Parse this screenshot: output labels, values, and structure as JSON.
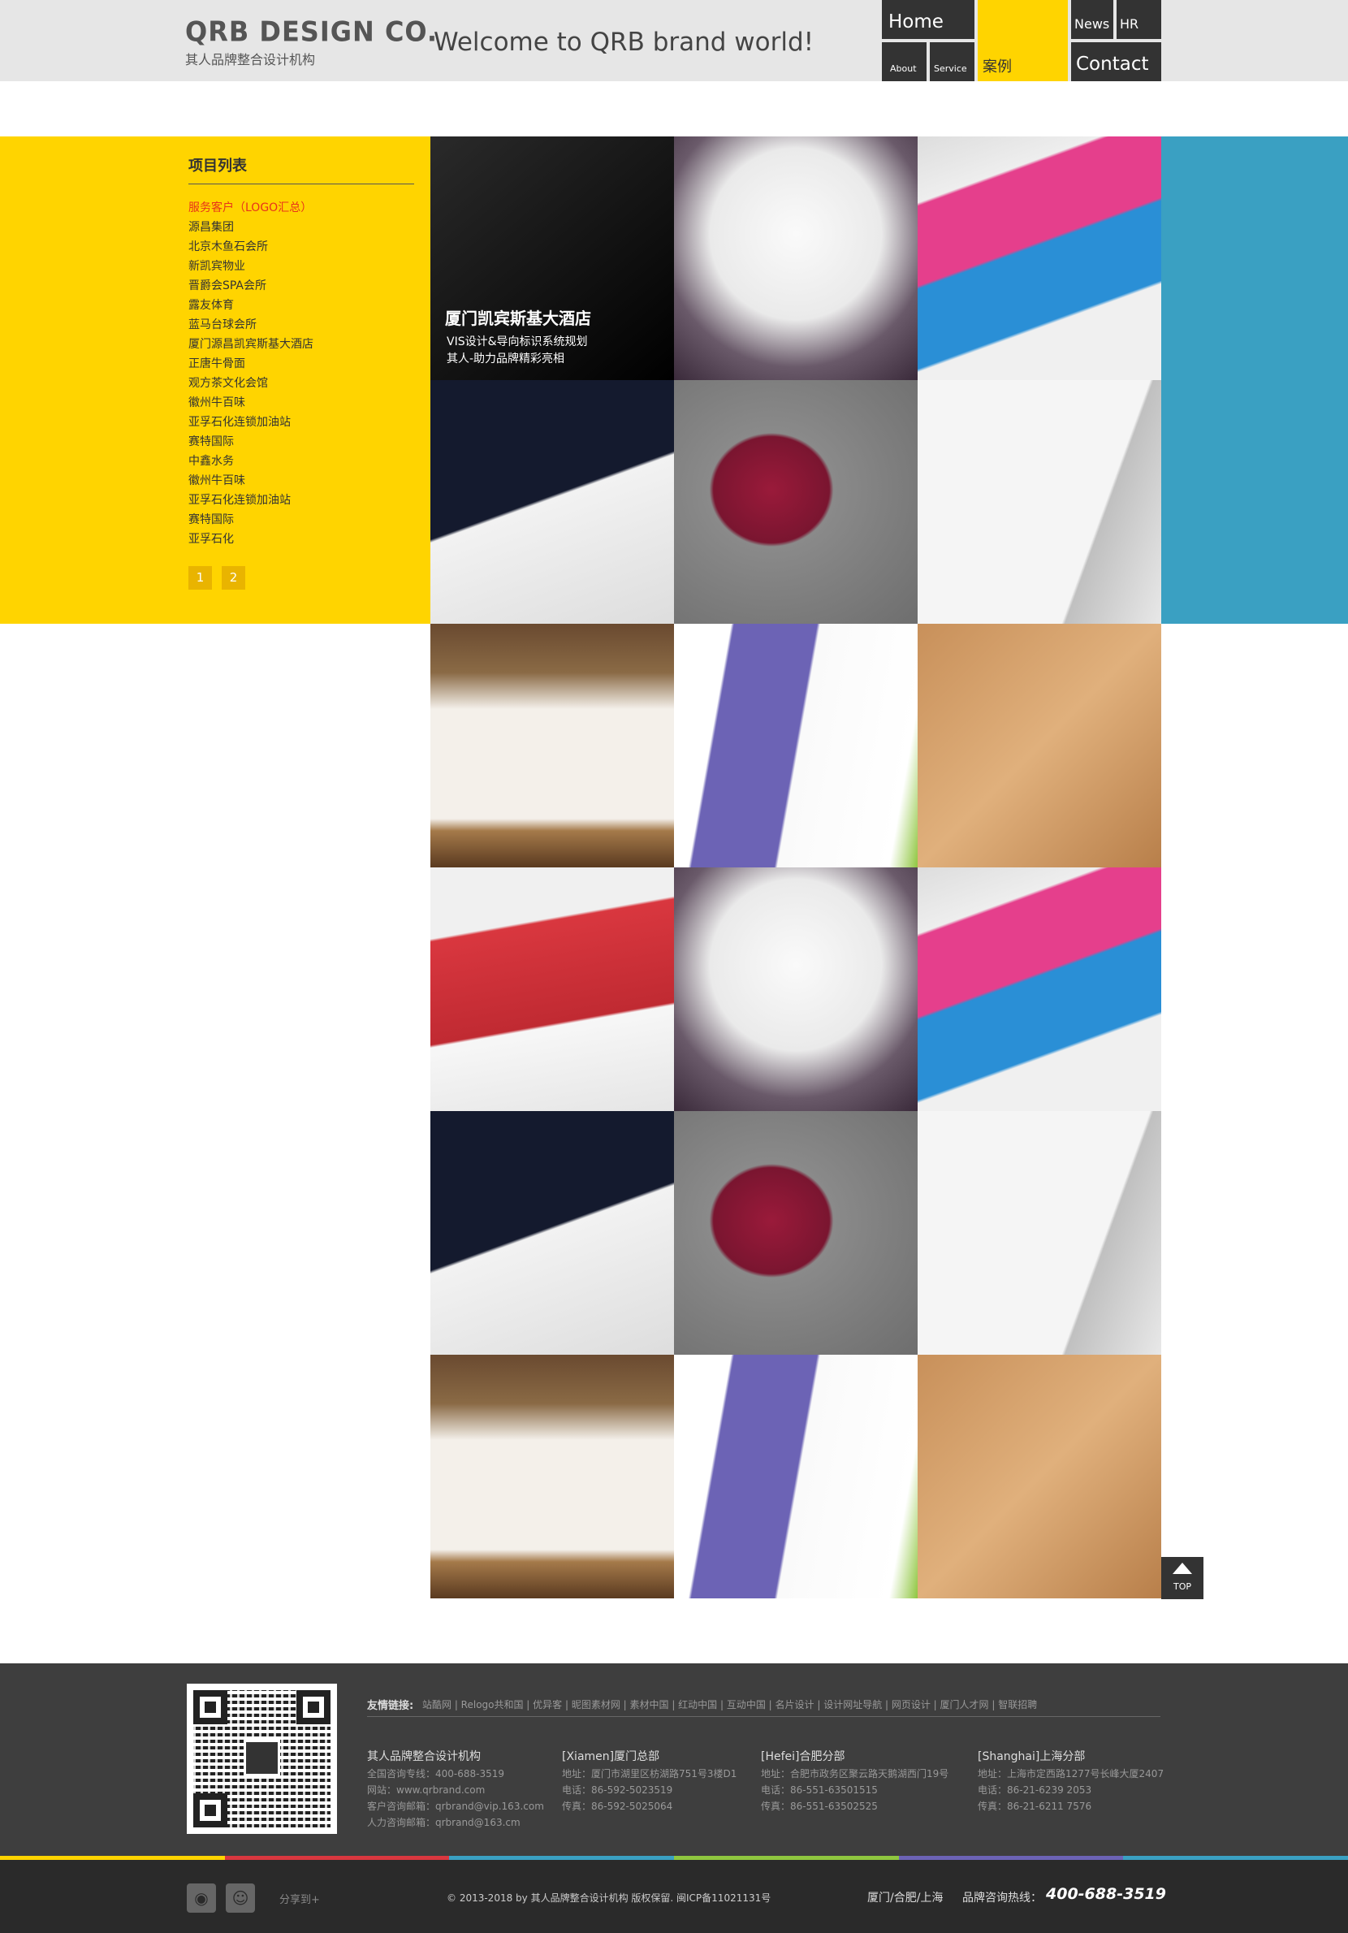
{
  "header": {
    "logo_main": "QRB DESIGN CO.",
    "logo_sub": "其人品牌整合设计机构",
    "welcome": "Welcome to QRB brand world!",
    "nav": {
      "home": "Home",
      "about": "About",
      "service": "Service",
      "case": "案例",
      "news": "News",
      "hr": "HR",
      "contact": "Contact"
    }
  },
  "sidebar": {
    "title": "项目列表",
    "items": [
      "服务客户（LOGO汇总）",
      "源昌集团",
      "北京木鱼石会所",
      "新凯宾物业",
      "晋爵会SPA会所",
      "露友体育",
      "蓝马台球会所",
      "厦门源昌凯宾斯基大酒店",
      "正唐牛骨面",
      "观方茶文化会馆",
      "徽州牛百味",
      "亚孚石化连锁加油站",
      "赛特国际",
      "中鑫水务",
      "徽州牛百味",
      "亚孚石化连锁加油站",
      "赛特国际",
      "亚孚石化"
    ],
    "pages": [
      "1",
      "2"
    ]
  },
  "featured": {
    "title": "厦门凯宾斯基大酒店",
    "sub1": "VIS设计&导向标识系统规划",
    "sub2": "其人-助力品牌精彩亮相"
  },
  "top_button": "TOP",
  "footer": {
    "links_label": "友情链接:",
    "links": "站酷网 | Relogo共和国 | 优异客 | 昵图素材网 | 素材中国 | 红动中国 | 互动中国 | 名片设计 | 设计网址导航 | 网页设计 | 厦门人才网 | 智联招聘",
    "columns": [
      {
        "title": "其人品牌整合设计机构",
        "lines": [
          "全国咨询专线：400-688-3519",
          "网站：www.qrbrand.com",
          "客户咨询邮箱：qrbrand@vip.163.com",
          "人力咨询邮箱：qrbrand@163.cm"
        ]
      },
      {
        "title": "[Xiamen]厦门总部",
        "lines": [
          "地址：厦门市湖里区枋湖路751号3楼D1",
          "电话：86-592-5023519",
          "传真：86-592-5025064"
        ]
      },
      {
        "title": "[Hefei]合肥分部",
        "lines": [
          "地址：合肥市政务区聚云路天鹅湖西门19号",
          "电话：86-551-63501515",
          "传真：86-551-63502525"
        ]
      },
      {
        "title": "[Shanghai]上海分部",
        "lines": [
          "地址：上海市定西路1277号长峰大厦2407",
          "电话：86-21-6239 2053",
          "传真：86-21-6211 7576"
        ]
      }
    ],
    "share": "分享到+",
    "copyright": "© 2013-2018 by 其人品牌整合设计机构    版权保留. 闽ICP备11021131号",
    "cities": "厦门/合肥/上海",
    "hotline_label": "品牌咨询热线：",
    "hotline": "400-688-3519"
  },
  "colors": {
    "accent_yellow": "#ffd400",
    "accent_blue": "#3aa0c2",
    "nav_dark": "#333333",
    "footer_dark": "#3e3e3e",
    "stripe": [
      "#ffd400",
      "#d9373f",
      "#3aa0c2",
      "#8fc63f",
      "#6c63b5",
      "#3aa0c2"
    ]
  }
}
